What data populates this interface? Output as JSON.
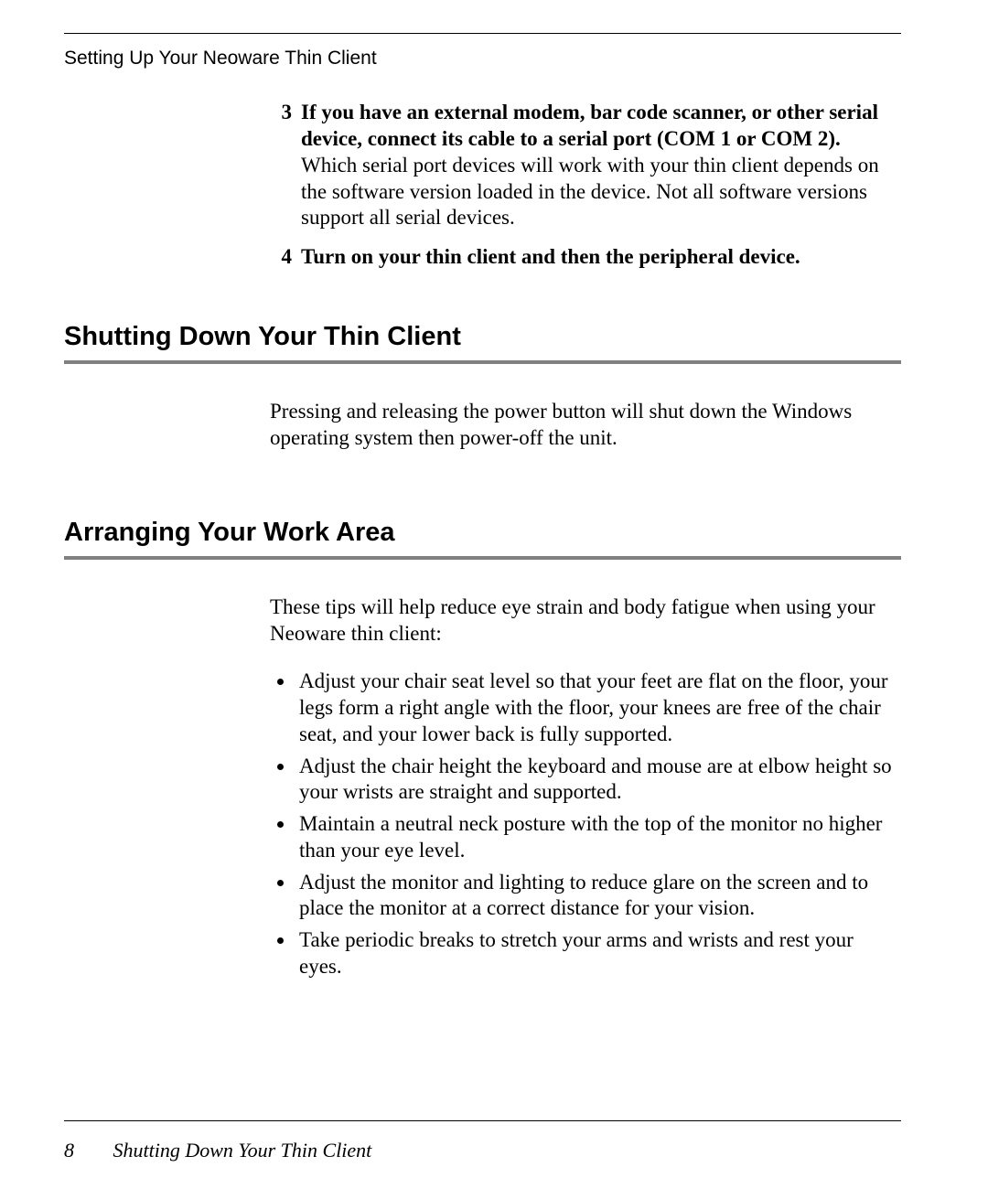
{
  "running_head": "Setting Up Your Neoware Thin Client",
  "steps": {
    "s3": {
      "num": "3",
      "bold": "If you have an external modem, bar code scanner, or other serial device, connect its cable to a serial port (COM 1 or COM 2).",
      "rest": " Which serial port devices will work with your thin client depends on the software version loaded in the device. Not all software versions support all serial devices."
    },
    "s4": {
      "num": "4",
      "bold": "Turn on your thin client and then the peripheral device."
    }
  },
  "section1": {
    "title": "Shutting Down Your Thin Client",
    "para": "Pressing and releasing the power button will shut down the Windows operating system then power-off the unit."
  },
  "section2": {
    "title": "Arranging Your Work Area",
    "intro": "These tips will help reduce eye strain and body fatigue when using your Neoware thin client:",
    "bullets": [
      "Adjust your chair seat level so that your feet are flat on the floor, your legs form a right angle with the floor, your knees are free of the chair seat, and your lower back is fully supported.",
      "Adjust the chair height the keyboard and mouse are at elbow height so your wrists are straight and supported.",
      "Maintain a neutral neck posture with the top of the monitor no higher than your eye level.",
      "Adjust the monitor and lighting to reduce glare on the screen and to place the monitor at a correct distance for your vision.",
      "Take periodic breaks to stretch your arms and wrists and rest your eyes."
    ]
  },
  "footer": {
    "page_number": "8",
    "section": "Shutting Down Your Thin Client"
  }
}
